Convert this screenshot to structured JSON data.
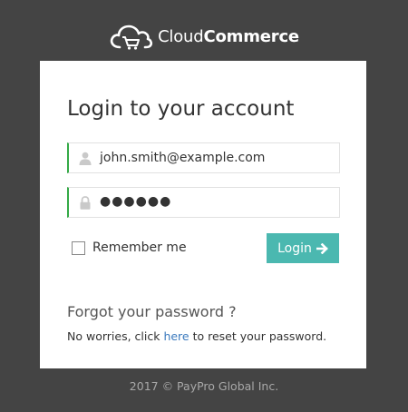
{
  "brand": {
    "logo_part1": "Cloud",
    "logo_part2": "Commerce"
  },
  "login": {
    "title": "Login to your account",
    "username_value": "john.smith@example.com",
    "username_icon": "user-icon",
    "password_value": "●●●●●●",
    "password_icon": "lock-icon",
    "remember_label": "Remember me",
    "remember_checked": false,
    "login_button_label": "Login",
    "login_button_icon": "arrow-right-icon",
    "button_color": "#4bb8b0",
    "field_accent_color": "#35aa47"
  },
  "forgot": {
    "title": "Forgot your password ?",
    "text_before": "No worries, click ",
    "link_text": "here",
    "text_after": " to reset your password."
  },
  "footer": {
    "copyright": "2017 © PayPro Global Inc."
  }
}
